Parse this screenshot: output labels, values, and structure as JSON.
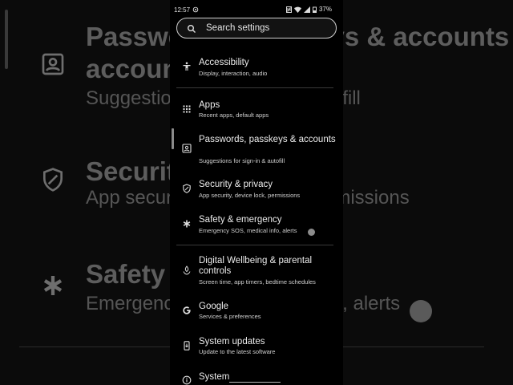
{
  "status_bar": {
    "time": "12:57",
    "battery": "37%"
  },
  "search": {
    "placeholder": "Search settings"
  },
  "items": [
    {
      "title": "Accessibility",
      "subtitle": "Display, interaction, audio",
      "icon": "accessibility-icon"
    },
    {
      "title": "Apps",
      "subtitle": "Recent apps, default apps",
      "icon": "apps-grid-icon"
    },
    {
      "title": "Passwords, passkeys & accounts",
      "subtitle": "Suggestions for sign-in & autofill",
      "icon": "account-box-icon"
    },
    {
      "title": "Security & privacy",
      "subtitle": "App security, device lock, permissions",
      "icon": "shield-icon"
    },
    {
      "title": "Safety & emergency",
      "subtitle": "Emergency SOS, medical info, alerts",
      "icon": "asterisk-icon"
    },
    {
      "title": "Digital Wellbeing & parental controls",
      "subtitle": "Screen time, app timers, bedtime schedules",
      "icon": "wellbeing-icon"
    },
    {
      "title": "Google",
      "subtitle": "Services & preferences",
      "icon": "google-icon"
    },
    {
      "title": "System updates",
      "subtitle": "Update to the latest software",
      "icon": "system-update-icon"
    },
    {
      "title": "System",
      "subtitle": "",
      "icon": "info-icon"
    }
  ],
  "background": {
    "rows": [
      {
        "title": "Passwords, passkeys & accounts",
        "subtitle": "Suggestions for sign-in & autofill"
      },
      {
        "title": "Security & privacy",
        "subtitle": "App security, device lock, permissions"
      },
      {
        "title": "Safety & emergency",
        "subtitle": "Emergency SOS, medical info, alerts"
      }
    ]
  }
}
